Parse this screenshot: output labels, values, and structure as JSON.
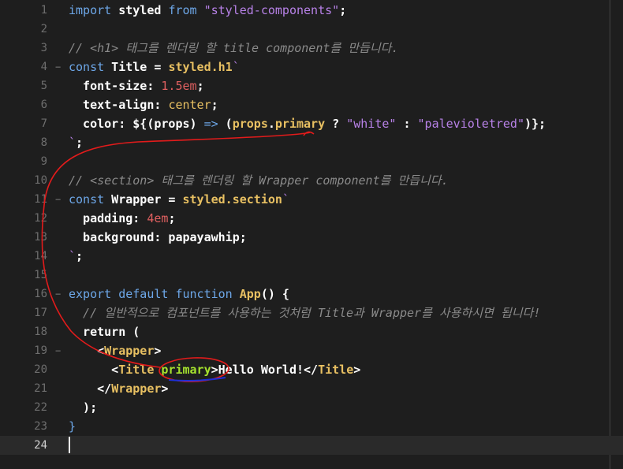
{
  "editor": {
    "active_line": 24,
    "lines": [
      {
        "n": "1",
        "parts": [
          [
            "kw",
            "import"
          ],
          [
            "p",
            " styled "
          ],
          [
            "kw",
            "from"
          ],
          [
            "p",
            " "
          ],
          [
            "str",
            "\"styled-components\""
          ],
          [
            "p",
            ";"
          ]
        ]
      },
      {
        "n": "2",
        "parts": []
      },
      {
        "n": "3",
        "parts": [
          [
            "cmt",
            "// <h1> 태그를 렌더링 할 title component를 만듭니다."
          ]
        ]
      },
      {
        "n": "4",
        "parts": [
          [
            "kw",
            "const"
          ],
          [
            "p",
            " Title = "
          ],
          [
            "fn",
            "styled.h1"
          ],
          [
            "str",
            "`"
          ]
        ]
      },
      {
        "n": "5",
        "parts": [
          [
            "p",
            "  font-size: "
          ],
          [
            "num",
            "1.5em"
          ],
          [
            "p",
            ";"
          ]
        ]
      },
      {
        "n": "6",
        "parts": [
          [
            "p",
            "  text-align: "
          ],
          [
            "val",
            "center"
          ],
          [
            "p",
            ";"
          ]
        ]
      },
      {
        "n": "7",
        "parts": [
          [
            "p",
            "  color: ${(props) "
          ],
          [
            "arrow",
            "=>"
          ],
          [
            "p",
            " ("
          ],
          [
            "fn",
            "props"
          ],
          [
            "p",
            "."
          ],
          [
            "fn",
            "primary"
          ],
          [
            "p",
            " ? "
          ],
          [
            "str",
            "\"white\""
          ],
          [
            "p",
            " : "
          ],
          [
            "str",
            "\"palevioletred\""
          ],
          [
            "p",
            ")};"
          ]
        ]
      },
      {
        "n": "8",
        "parts": [
          [
            "str",
            "`"
          ],
          [
            "p",
            ";"
          ]
        ]
      },
      {
        "n": "9",
        "parts": []
      },
      {
        "n": "10",
        "parts": [
          [
            "cmt",
            "// <section> 태그를 렌더링 할 Wrapper component를 만듭니다."
          ]
        ]
      },
      {
        "n": "11",
        "parts": [
          [
            "kw",
            "const"
          ],
          [
            "p",
            " Wrapper = "
          ],
          [
            "fn",
            "styled.section"
          ],
          [
            "str",
            "`"
          ]
        ]
      },
      {
        "n": "12",
        "parts": [
          [
            "p",
            "  padding: "
          ],
          [
            "num",
            "4em"
          ],
          [
            "p",
            ";"
          ]
        ]
      },
      {
        "n": "13",
        "parts": [
          [
            "p",
            "  background: papayawhip;"
          ]
        ]
      },
      {
        "n": "14",
        "parts": [
          [
            "str",
            "`"
          ],
          [
            "p",
            ";"
          ]
        ]
      },
      {
        "n": "15",
        "parts": []
      },
      {
        "n": "16",
        "parts": [
          [
            "kw",
            "export default function"
          ],
          [
            "p",
            " "
          ],
          [
            "fn",
            "App"
          ],
          [
            "p",
            "() {"
          ]
        ]
      },
      {
        "n": "17",
        "parts": [
          [
            "cmt",
            "  // 일반적으로 컴포넌트를 사용하는 것처럼 Title과 Wrapper를 사용하시면 됩니다!"
          ]
        ]
      },
      {
        "n": "18",
        "parts": [
          [
            "p",
            "  return ("
          ]
        ]
      },
      {
        "n": "19",
        "parts": [
          [
            "p",
            "    <"
          ],
          [
            "tag",
            "Wrapper"
          ],
          [
            "p",
            ">"
          ]
        ]
      },
      {
        "n": "20",
        "parts": [
          [
            "p",
            "      <"
          ],
          [
            "tag",
            "Title"
          ],
          [
            "p",
            " "
          ],
          [
            "attr",
            "primary"
          ],
          [
            "p",
            ">Hello World!</"
          ],
          [
            "tag",
            "Title"
          ],
          [
            "p",
            ">"
          ]
        ]
      },
      {
        "n": "21",
        "parts": [
          [
            "p",
            "    </"
          ],
          [
            "tag",
            "Wrapper"
          ],
          [
            "p",
            ">"
          ]
        ]
      },
      {
        "n": "22",
        "parts": [
          [
            "p",
            "  );"
          ]
        ]
      },
      {
        "n": "23",
        "parts": [
          [
            "kw",
            "}"
          ]
        ]
      },
      {
        "n": "24",
        "parts": []
      }
    ]
  },
  "colors": {
    "background": "#1e1e1e",
    "annotation_red": "#e31b1b",
    "annotation_blue": "#1d2fd6"
  }
}
